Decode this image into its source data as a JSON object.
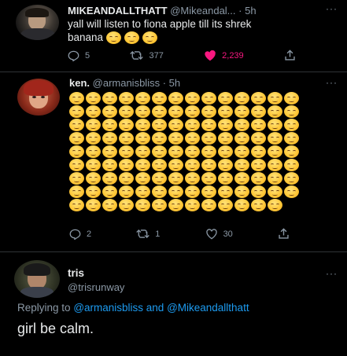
{
  "tweet1": {
    "name": "MIKEANDALLTHATT",
    "handle": "@Mikeandal...",
    "time": "5h",
    "text_line1": "yall will listen to fiona apple till its shrek",
    "text_line2": "banana",
    "replies": "5",
    "retweets": "377",
    "likes": "2,239"
  },
  "tweet2": {
    "name": "ken.",
    "handle": "@armanisbliss",
    "time": "5h",
    "emoji_count": 125,
    "emoji_name": "relieved-face",
    "replies": "2",
    "retweets": "1",
    "likes": "30"
  },
  "tweet3": {
    "name": "tris",
    "handle": "@trisrunway",
    "replying_prefix": "Replying to",
    "replying_to": "@armanisbliss and @Mikeandallthatt",
    "text": "girl be calm."
  },
  "colors": {
    "like_active": "#f91880",
    "link": "#1d9bf0",
    "muted": "#8b98a5",
    "background": "#000000"
  }
}
